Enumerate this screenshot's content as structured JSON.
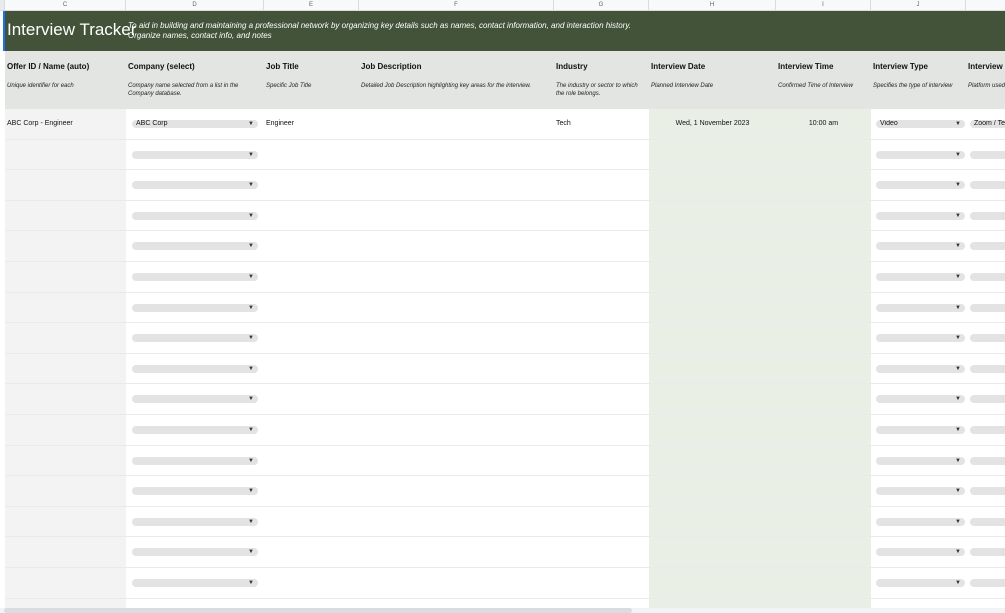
{
  "column_letters": [
    "C",
    "D",
    "E",
    "F",
    "G",
    "H",
    "I",
    "J",
    ""
  ],
  "banner": {
    "title": "Interview Tracker",
    "desc_line1": "To aid in building and maintaining a professional network by organizing key details such as names, contact information, and interaction history.",
    "desc_line2": "Organize names, contact info, and notes"
  },
  "headers": [
    {
      "title": "Offer ID / Name (auto)",
      "sub": "Unique identifier for each"
    },
    {
      "title": "Company (select)",
      "sub": "Company name selected from a list in the Company database."
    },
    {
      "title": "Job Title",
      "sub": "Specific Job Title"
    },
    {
      "title": "Job Description",
      "sub": "Detailed Job Description highlighting key areas for the interview."
    },
    {
      "title": "Industry",
      "sub": "The industry or sector to which the role belongs."
    },
    {
      "title": "Interview Date",
      "sub": "Planned Interview Date"
    },
    {
      "title": "Interview Time",
      "sub": "Confirmed Time of Interview"
    },
    {
      "title": "Interview Type",
      "sub": "Specifies the type of interview"
    },
    {
      "title": "Interview P",
      "sub": "Platform used"
    }
  ],
  "first_row": {
    "offer_id": "ABC Corp - Engineer",
    "company": "ABC Corp",
    "job_title": "Engineer",
    "job_description": "",
    "industry": "Tech",
    "interview_date": "Wed, 1 November 2023",
    "interview_time": "10:00 am",
    "interview_type": "Video",
    "platform": "Zoom / Te"
  },
  "empty_row_count": 15,
  "colors": {
    "banner": "#435339",
    "header": "#e3e5e2",
    "date_col": "#e9efe5",
    "id_col": "#f3f3f3"
  }
}
